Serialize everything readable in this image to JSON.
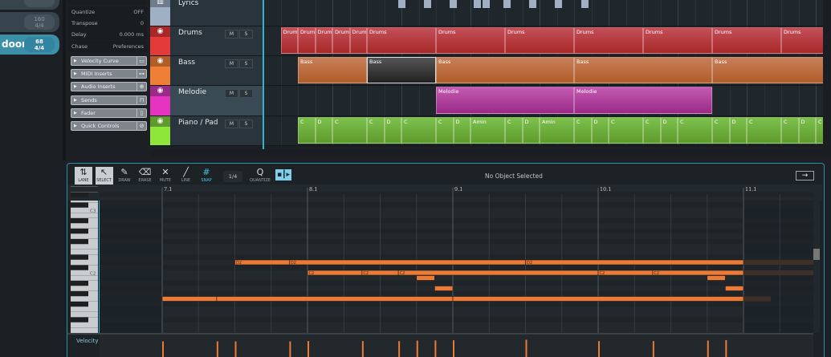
{
  "songs": [
    {
      "name": "",
      "tempo": "",
      "sig": "4/4",
      "active": false
    },
    {
      "name": "",
      "tempo": "160",
      "sig": "4/4",
      "active": false
    },
    {
      "name": "door",
      "tempo": "68",
      "sig": "4/4",
      "active": true
    }
  ],
  "inspector": {
    "rows": [
      {
        "label": "Quantize",
        "value": "OFF"
      },
      {
        "label": "Transpose",
        "value": "0"
      },
      {
        "label": "Delay",
        "value": "0.000 ms"
      }
    ],
    "chase": {
      "label": "Chase",
      "value": "Preferences"
    },
    "sections": [
      {
        "label": "Velocity Curve",
        "icon": "curve-icon",
        "glyph": "▭"
      },
      {
        "label": "MIDI Inserts",
        "icon": "midi-insert-icon",
        "glyph": "⊶"
      },
      {
        "label": "Audio Inserts",
        "icon": "audio-insert-icon",
        "glyph": "⊕"
      },
      {
        "label": "Sends",
        "icon": "sends-icon",
        "glyph": "⊓"
      },
      {
        "label": "Fader",
        "icon": "fader-icon",
        "glyph": "▯"
      },
      {
        "label": "Quick Controls",
        "icon": "quick-controls-icon",
        "glyph": "⊘"
      }
    ]
  },
  "tracks": [
    {
      "name": "Lyrics",
      "color": "#9fb0c4",
      "head": "#6f7d8a",
      "icon": "book-icon",
      "glyph": "▥",
      "ms": false
    },
    {
      "name": "Drums",
      "color": "#e43a3a",
      "head": "#a82828",
      "icon": "midi-icon",
      "glyph": "◉",
      "ms": true,
      "clipColor": "#c4505a"
    },
    {
      "name": "Bass",
      "color": "#ee7f35",
      "head": "#b05d28",
      "icon": "midi-icon",
      "glyph": "◉",
      "ms": true,
      "clipColor": "#c77f5a"
    },
    {
      "name": "Melodie",
      "color": "#e535c0",
      "head": "#9a2a86",
      "icon": "midi-icon",
      "glyph": "◉",
      "ms": true,
      "clipColor": "#c45bb2",
      "selected": true
    },
    {
      "name": "Piano / Pad",
      "color": "#8ee63a",
      "head": "#5f9a2c",
      "icon": "midi-icon",
      "glyph": "◉",
      "ms": true,
      "clipColor": "#7cc14c"
    }
  ],
  "mute_label": "M",
  "solo_label": "S",
  "clips": {
    "Drums": [
      {
        "name": "Drums",
        "start": 2,
        "end": 3
      },
      {
        "name": "Drums",
        "start": 3,
        "end": 4
      },
      {
        "name": "Drums",
        "start": 4,
        "end": 5
      },
      {
        "name": "Drums",
        "start": 5,
        "end": 6
      },
      {
        "name": "Drums",
        "start": 6,
        "end": 7
      },
      {
        "name": "Drums",
        "start": 7,
        "end": 11
      },
      {
        "name": "Drums",
        "start": 11,
        "end": 15
      },
      {
        "name": "Drums",
        "start": 15,
        "end": 19
      },
      {
        "name": "Drums",
        "start": 19,
        "end": 23
      },
      {
        "name": "Drums",
        "start": 23,
        "end": 27
      },
      {
        "name": "Drums",
        "start": 27,
        "end": 31
      },
      {
        "name": "Drums",
        "start": 31,
        "end": 34
      }
    ],
    "Bass": [
      {
        "name": "Bass",
        "start": 3,
        "end": 7
      },
      {
        "name": "Bass",
        "start": 7,
        "end": 11,
        "selected": true
      },
      {
        "name": "Bass",
        "start": 11,
        "end": 19
      },
      {
        "name": "Bass",
        "start": 19,
        "end": 27
      },
      {
        "name": "Bass",
        "start": 27,
        "end": 34
      }
    ],
    "Melodie": [
      {
        "name": "Melodie",
        "start": 11,
        "end": 19
      },
      {
        "name": "Melodie",
        "start": 19,
        "end": 27
      }
    ],
    "Piano / Pad": [
      {
        "name": "C",
        "start": 3,
        "end": 4
      },
      {
        "name": "D",
        "start": 4,
        "end": 5
      },
      {
        "name": "C",
        "start": 5,
        "end": 7
      },
      {
        "name": "C",
        "start": 7,
        "end": 8
      },
      {
        "name": "D",
        "start": 8,
        "end": 9
      },
      {
        "name": "C",
        "start": 9,
        "end": 11
      },
      {
        "name": "C",
        "start": 11,
        "end": 12
      },
      {
        "name": "D",
        "start": 12,
        "end": 13
      },
      {
        "name": "Amin",
        "start": 13,
        "end": 15
      },
      {
        "name": "C",
        "start": 15,
        "end": 16
      },
      {
        "name": "D",
        "start": 16,
        "end": 17
      },
      {
        "name": "Amin",
        "start": 17,
        "end": 19
      },
      {
        "name": "C",
        "start": 19,
        "end": 20
      },
      {
        "name": "D",
        "start": 20,
        "end": 21
      },
      {
        "name": "C",
        "start": 21,
        "end": 23
      },
      {
        "name": "C",
        "start": 23,
        "end": 24
      },
      {
        "name": "D",
        "start": 24,
        "end": 25
      },
      {
        "name": "C",
        "start": 25,
        "end": 27
      },
      {
        "name": "C",
        "start": 27,
        "end": 28
      },
      {
        "name": "D",
        "start": 28,
        "end": 29
      },
      {
        "name": "C",
        "start": 29,
        "end": 31
      },
      {
        "name": "C",
        "start": 31,
        "end": 32
      },
      {
        "name": "D",
        "start": 32,
        "end": 33
      },
      {
        "name": "C",
        "start": 33,
        "end": 34
      }
    ]
  },
  "lyrics_events": [
    8.8,
    10.3,
    11.8,
    13.2,
    13.7,
    14.9,
    16.4,
    17.9,
    19.4
  ],
  "editor": {
    "tools": [
      {
        "label": "LANE",
        "glyph": "⇅",
        "icon": "lane-icon",
        "sel": true
      },
      {
        "label": "SELECT",
        "glyph": "↖",
        "icon": "select-icon",
        "sel": true
      },
      {
        "label": "DRAW",
        "glyph": "✎",
        "icon": "draw-icon"
      },
      {
        "label": "ERASE",
        "glyph": "⌫",
        "icon": "erase-icon"
      },
      {
        "label": "MUTE",
        "glyph": "✕",
        "icon": "mute-icon"
      },
      {
        "label": "LINE",
        "glyph": "╱",
        "icon": "line-icon"
      },
      {
        "label": "SNAP",
        "glyph": "#",
        "icon": "snap-icon",
        "active": true
      }
    ],
    "quantize_value": "1/4",
    "quantize_label": "QUANTIZE",
    "quantize_glyph": "Q",
    "status": "No Object Selected",
    "ruler": [
      "7.1",
      "8.1",
      "9.1",
      "10.1",
      "11.1"
    ],
    "key_labels": [
      "C3",
      "C2"
    ],
    "velocity_label": "Velocity",
    "accent": "#ea7a35",
    "notes": [
      {
        "pitch": "D2",
        "start": 7.5,
        "end": 7.875
      },
      {
        "pitch": "D2",
        "start": 7.875,
        "end": 9.5
      },
      {
        "pitch": "D2",
        "start": 9.5,
        "end": 11.0
      },
      {
        "pitch": "C2",
        "start": 8.0,
        "end": 8.375
      },
      {
        "pitch": "C2",
        "start": 8.375,
        "end": 8.625
      },
      {
        "pitch": "C2",
        "start": 8.625,
        "end": 10.0
      },
      {
        "pitch": "C2",
        "start": 10.0,
        "end": 10.375
      },
      {
        "pitch": "C2",
        "start": 10.375,
        "end": 11.0
      },
      {
        "pitch": "B1",
        "start": 8.75,
        "end": 8.875
      },
      {
        "pitch": "B1",
        "start": 10.75,
        "end": 10.875
      },
      {
        "pitch": "A1",
        "start": 8.875,
        "end": 9.0
      },
      {
        "pitch": "A1",
        "start": 10.875,
        "end": 11.0
      },
      {
        "pitch": "G1",
        "start": 7.0,
        "end": 7.375
      },
      {
        "pitch": "G1",
        "start": 7.375,
        "end": 9.0
      },
      {
        "pitch": "G1",
        "start": 9.0,
        "end": 11.0
      }
    ],
    "velocities": [
      {
        "pos": 7.0,
        "v": 95
      },
      {
        "pos": 7.375,
        "v": 95
      },
      {
        "pos": 7.5,
        "v": 95
      },
      {
        "pos": 7.875,
        "v": 95
      },
      {
        "pos": 8.0,
        "v": 97
      },
      {
        "pos": 8.375,
        "v": 97
      },
      {
        "pos": 8.625,
        "v": 97
      },
      {
        "pos": 8.75,
        "v": 100
      },
      {
        "pos": 8.875,
        "v": 101
      },
      {
        "pos": 9.0,
        "v": 102
      },
      {
        "pos": 9.5,
        "v": 105
      },
      {
        "pos": 10.0,
        "v": 97
      },
      {
        "pos": 10.375,
        "v": 97
      },
      {
        "pos": 10.75,
        "v": 100
      },
      {
        "pos": 10.875,
        "v": 103
      }
    ]
  }
}
